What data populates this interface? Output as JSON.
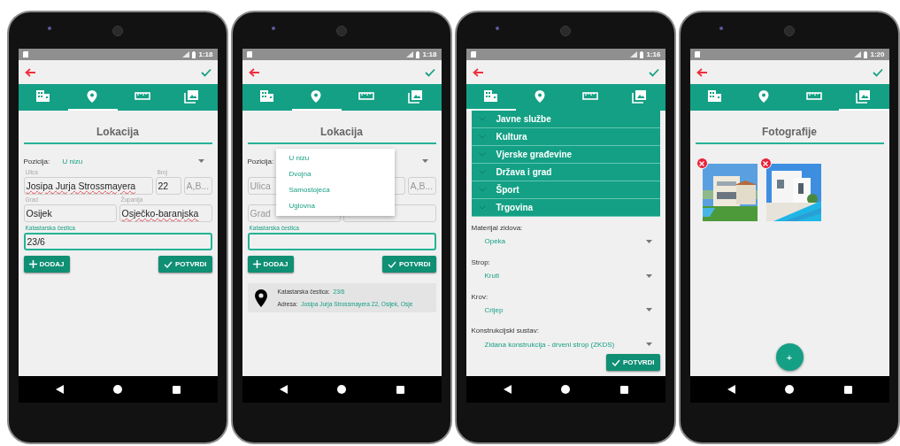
{
  "phones": [
    {
      "status": {
        "time": "1:18"
      },
      "tabs": [
        {
          "selected": false
        },
        {
          "selected": true
        },
        {
          "selected": false
        },
        {
          "selected": false
        }
      ],
      "screen": {
        "kind": "location",
        "title": "Lokacija",
        "position": {
          "label": "Pozicija:",
          "value": "U nizu"
        },
        "field_rows": [
          [
            {
              "label": "Ulica",
              "value": "Josipa Jurja Strossmayera",
              "misspelled": true
            },
            {
              "label": "Broj",
              "value": "22",
              "misspelled": false
            },
            {
              "placeholder": "A,B..."
            }
          ],
          [
            {
              "label": "Grad",
              "value": "Osijek",
              "misspelled": false
            },
            {
              "label": "Županija",
              "value": "Osječko-baranjska",
              "misspelled": true
            }
          ]
        ],
        "cadastral": {
          "label": "Katastarska čestica",
          "value": "23/6",
          "focused": true
        },
        "buttons": [
          "DODAJ",
          "POTVRDI"
        ]
      }
    },
    {
      "status": {
        "time": "1:18"
      },
      "tabs": [
        {
          "selected": false
        },
        {
          "selected": true
        },
        {
          "selected": false
        },
        {
          "selected": false
        }
      ],
      "screen": {
        "kind": "location",
        "title": "Lokacija",
        "position": {
          "label": "Pozicija:"
        },
        "field_rows": [
          [
            {
              "placeholder": "Ulica"
            },
            {},
            {
              "placeholder": "A,B..."
            }
          ],
          [
            {
              "placeholder": "Grad"
            },
            {}
          ]
        ],
        "cadastral": {
          "label": "Katastarska čestica",
          "focused": true
        },
        "buttons": [
          "DODAJ",
          "POTVRDI"
        ],
        "summary": [
          {
            "label": "Katastarska čestica:",
            "value": "23/6"
          },
          {
            "label": "Adresa:",
            "value": "Josipa Jurja Strossmayera 22, Osijek, Osje"
          }
        ],
        "menu": {
          "items": [
            "U nizu",
            "Dvojna",
            "Samostojeća",
            "Uglovna"
          ]
        }
      }
    },
    {
      "status": {
        "time": "1:16"
      },
      "tabs": [
        {
          "selected": true
        },
        {
          "selected": false
        },
        {
          "selected": false
        },
        {
          "selected": false
        }
      ],
      "screen": {
        "kind": "details",
        "groups": [
          "Javne službe",
          "Kultura",
          "Vjerske građevine",
          "Država i grad",
          "Šport",
          "Trgovina"
        ],
        "spinners": [
          {
            "label": "Materijal zidova:",
            "value": "Opeka"
          },
          {
            "label": "Strop:",
            "value": "Kruti"
          },
          {
            "label": "Krov:",
            "value": "Crijep"
          },
          {
            "label": "Konstrukcijski sustav:",
            "value": "Zidana konstrukcija - drveni strop (ZKDS)"
          }
        ],
        "button": "POTVRDI"
      }
    },
    {
      "status": {
        "time": "1:20"
      },
      "tabs": [
        {
          "selected": false
        },
        {
          "selected": false
        },
        {
          "selected": false
        },
        {
          "selected": true
        }
      ],
      "screen": {
        "kind": "photos",
        "title": "Fotografije",
        "fab": "+"
      }
    }
  ]
}
